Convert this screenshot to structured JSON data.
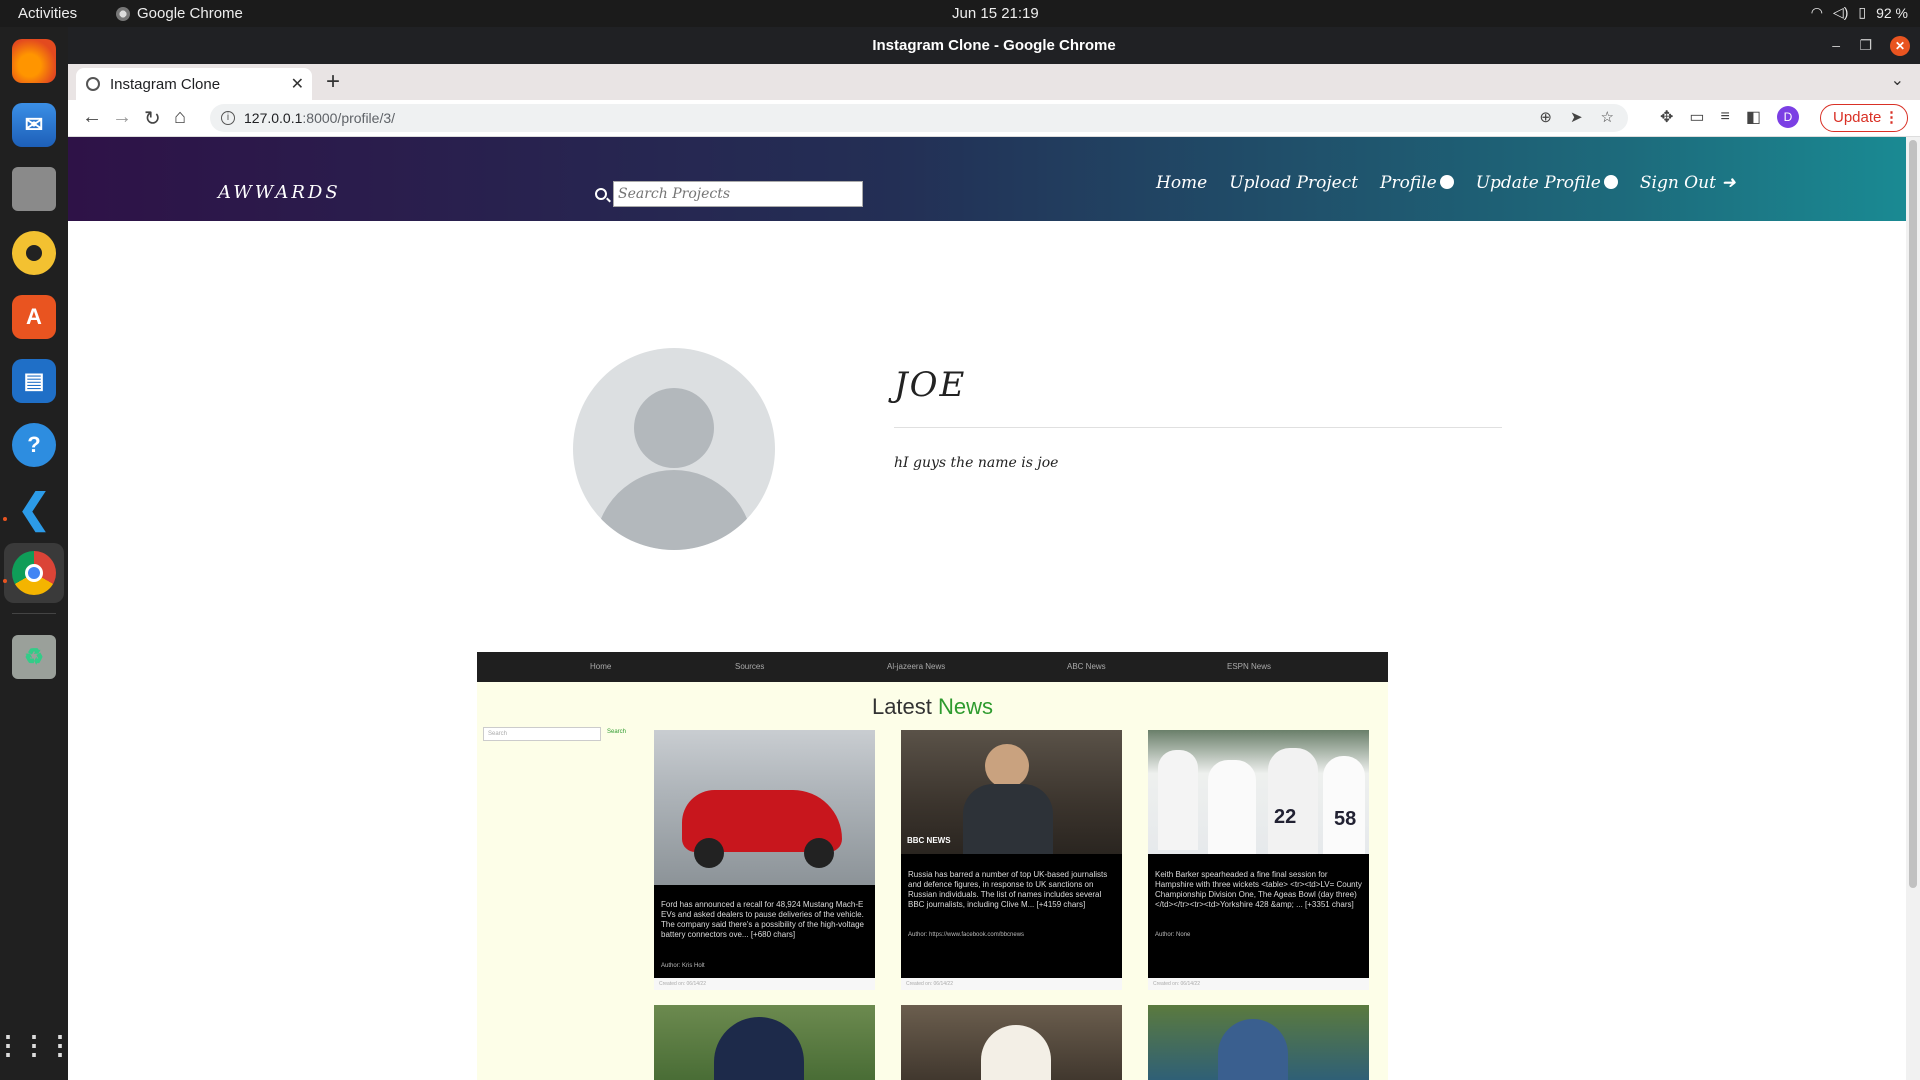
{
  "system": {
    "activities": "Activities",
    "app_name": "Google Chrome",
    "clock": "Jun 15  21:19",
    "battery": "92 %"
  },
  "window": {
    "title": "Instagram Clone - Google Chrome",
    "tab_title": "Instagram Clone",
    "url_host": "127.0.0.1",
    "url_path": ":8000/profile/3/",
    "update_label": "Update",
    "profile_initial": "D"
  },
  "site": {
    "brand": "AWWARDS",
    "search_placeholder": "Search Projects",
    "nav": {
      "home": "Home",
      "upload": "Upload Project",
      "profile": "Profile",
      "update_profile": "Update Profile",
      "sign_out": "Sign Out"
    }
  },
  "profile": {
    "username": "JOE",
    "bio": "hI guys the name is joe"
  },
  "news_embed": {
    "nav": [
      "Home",
      "Sources",
      "Al-jazeera News",
      "ABC News",
      "ESPN News"
    ],
    "title_main": "Latest",
    "title_accent": "News",
    "search_placeholder": "Search",
    "search_button": "Search",
    "cards": [
      {
        "text": "Ford has announced a recall for 48,924 Mustang Mach-E EVs and asked dealers to pause deliveries of the vehicle. The company said there's a possibility of the high-voltage battery connectors ove... [+680 chars]",
        "author": "Author: Kris Holt",
        "created": "Created on: 06/14/22"
      },
      {
        "text": "Russia has barred a number of top UK-based journalists and defence figures, in response to UK sanctions on Russian individuals. The list of names includes several BBC journalists, including Clive M... [+4159 chars]",
        "author": "Author: https://www.facebook.com/bbcnews",
        "created": "Created on: 06/14/22"
      },
      {
        "text": "Keith Barker spearheaded a fine final session for Hampshire with three wickets <table> <tr><td>LV= County Championship Division One, The Ageas Bowl (day three)</td></tr><tr><td>Yorkshire 428 &amp; ... [+3351 chars]",
        "author": "Author: None",
        "created": "Created on: 06/14/22"
      }
    ]
  },
  "colors": {
    "nav_start": "#2e1247",
    "nav_end": "#1a8a93",
    "news_accent": "#2e9b2e",
    "news_bg": "#fdfee8"
  }
}
